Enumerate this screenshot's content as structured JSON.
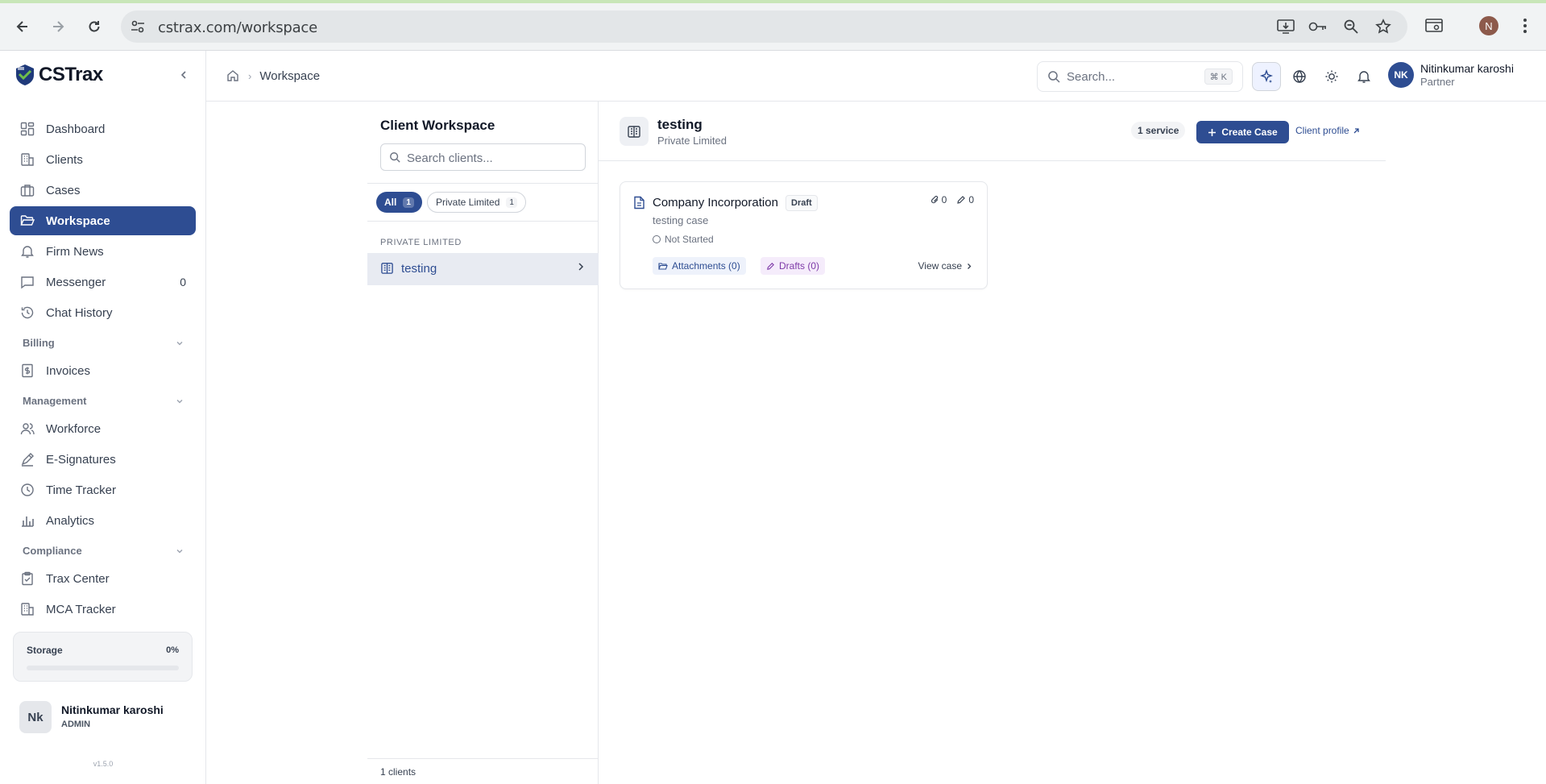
{
  "browser": {
    "url": "cstrax.com/workspace",
    "profile_initial": "N"
  },
  "brand": {
    "name": "CSTrax"
  },
  "sidebar": {
    "items": [
      {
        "label": "Dashboard"
      },
      {
        "label": "Clients"
      },
      {
        "label": "Cases"
      },
      {
        "label": "Workspace",
        "active": true
      },
      {
        "label": "Firm News"
      },
      {
        "label": "Messenger",
        "count": "0"
      },
      {
        "label": "Chat History"
      }
    ],
    "billing": {
      "heading": "Billing",
      "items": [
        {
          "label": "Invoices"
        }
      ]
    },
    "management": {
      "heading": "Management",
      "items": [
        {
          "label": "Workforce"
        },
        {
          "label": "E-Signatures"
        },
        {
          "label": "Time Tracker"
        },
        {
          "label": "Analytics"
        }
      ]
    },
    "compliance": {
      "heading": "Compliance",
      "items": [
        {
          "label": "Trax Center"
        },
        {
          "label": "MCA Tracker"
        }
      ]
    },
    "storage": {
      "label": "Storage",
      "percent_text": "0%",
      "fraction": 0
    },
    "user": {
      "initials": "Nk",
      "name": "Nitinkumar karoshi",
      "role": "ADMIN"
    },
    "version": "v1.5.0"
  },
  "header": {
    "breadcrumb": {
      "current": "Workspace"
    },
    "search": {
      "placeholder": "Search...",
      "shortcut": "⌘ K"
    },
    "user": {
      "initials": "NK",
      "name": "Nitinkumar karoshi",
      "role": "Partner"
    }
  },
  "clients_panel": {
    "title": "Client Workspace",
    "search_placeholder": "Search clients...",
    "filters": [
      {
        "label": "All",
        "count": "1",
        "active": true
      },
      {
        "label": "Private Limited",
        "count": "1",
        "active": false
      }
    ],
    "group_label": "PRIVATE LIMITED",
    "clients": [
      {
        "name": "testing"
      }
    ],
    "footer_count": "1 clients"
  },
  "detail": {
    "client_name": "testing",
    "client_type": "Private Limited",
    "service_badge": "1 service",
    "create_case_label": "Create Case",
    "client_profile_label": "Client profile",
    "cases": [
      {
        "title": "Company Incorporation",
        "badge": "Draft",
        "attachments_count": "0",
        "drafts_count": "0",
        "description": "testing case",
        "status": "Not Started",
        "attachments_label": "Attachments (0)",
        "drafts_label": "Drafts (0)",
        "view_label": "View case"
      }
    ]
  },
  "colors": {
    "accent": "#2e4d92",
    "draft_purple": "#7e3aa8"
  }
}
